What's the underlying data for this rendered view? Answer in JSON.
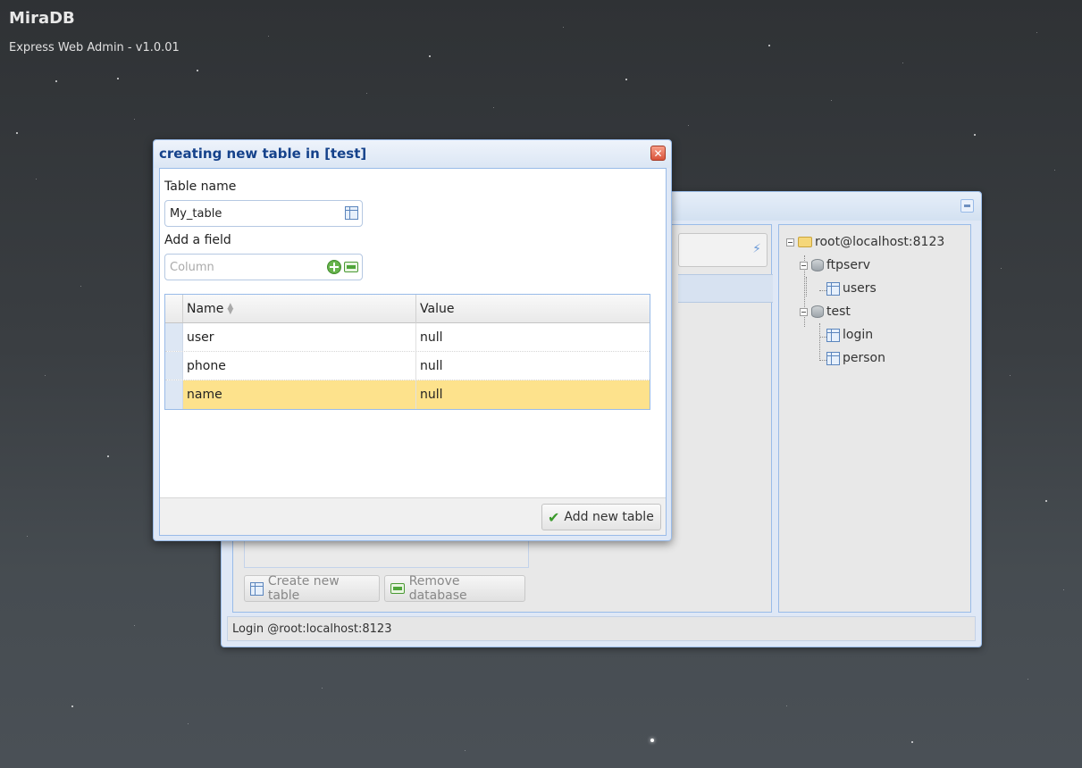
{
  "app": {
    "title": "MiraDB",
    "subtitle": "Express Web Admin - v1.0.01"
  },
  "back_window": {
    "buttons": {
      "create_table": "Create new table",
      "remove_database": "Remove database"
    },
    "tree": {
      "root": "root@localhost:8123",
      "databases": [
        {
          "name": "ftpserv",
          "tables": [
            "users"
          ]
        },
        {
          "name": "test",
          "tables": [
            "login",
            "person"
          ]
        }
      ]
    },
    "status": "Login @root:localhost:8123"
  },
  "dialog": {
    "title": "creating new table in [test]",
    "table_name_label": "Table name",
    "table_name_value": "My_table",
    "add_field_label": "Add a field",
    "column_placeholder": "Column",
    "grid": {
      "columns": [
        "Name",
        "Value"
      ],
      "rows": [
        {
          "name": "user",
          "value": "null"
        },
        {
          "name": "phone",
          "value": "null"
        },
        {
          "name": "name",
          "value": "null"
        }
      ],
      "selected_row": 2
    },
    "add_button": "Add new table"
  },
  "colors": {
    "window_border": "#99bbe8",
    "title_text": "#15428b",
    "selected_row": "#fde28c"
  }
}
